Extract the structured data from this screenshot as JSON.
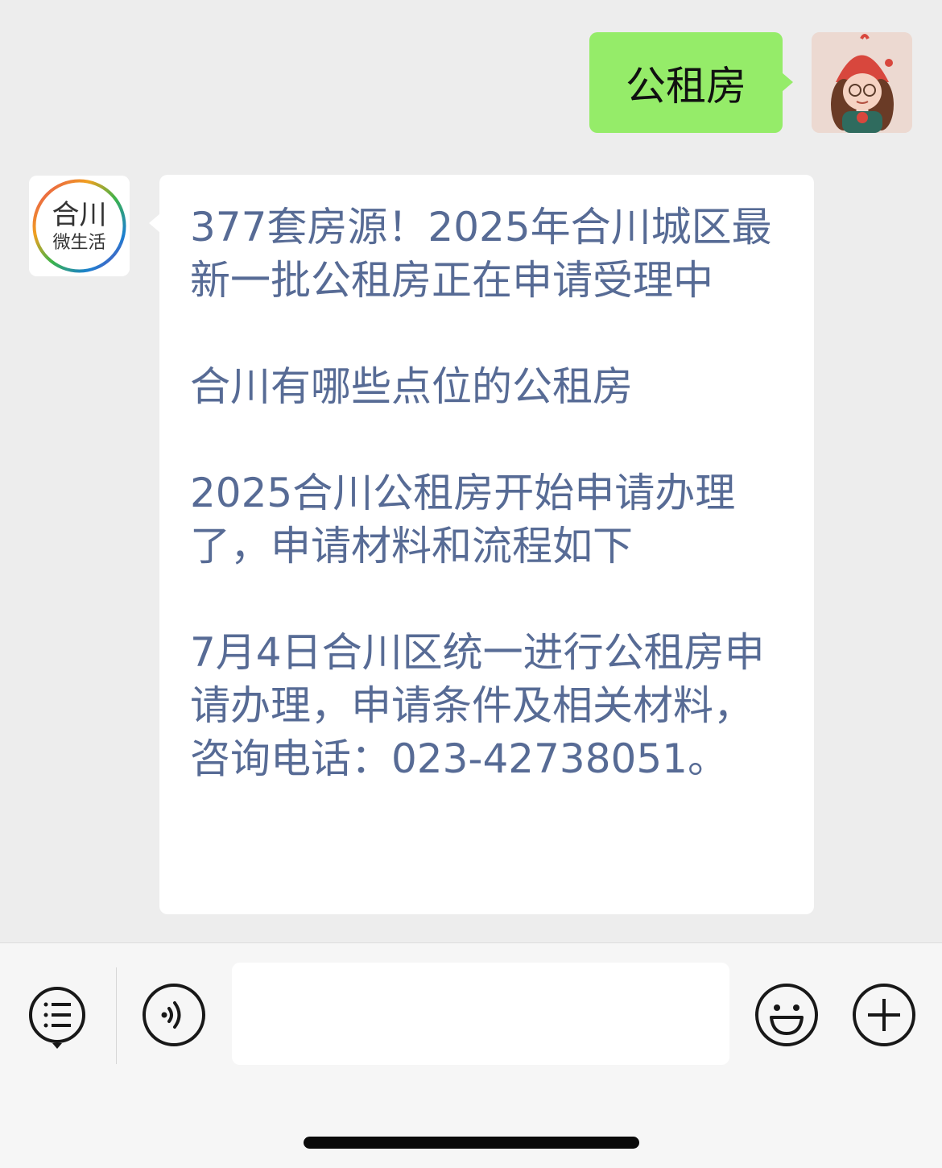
{
  "messages": {
    "outgoing": {
      "text": "公租房"
    },
    "incoming": {
      "logo_text_1": "合川",
      "logo_text_2": "微生活",
      "paragraphs": [
        "377套房源！2025年合川城区最新一批公租房正在申请受理中",
        "合川有哪些点位的公租房",
        "2025合川公租房开始申请办理了，申请材料和流程如下",
        "7月4日合川区统一进行公租房申请办理，申请条件及相关材料，咨询电话：023-42738051。"
      ]
    }
  },
  "input_bar": {
    "menu_icon": "menu-list-icon",
    "voice_icon": "voice-icon",
    "emoji_icon": "emoji-icon",
    "plus_icon": "plus-icon",
    "text_value": ""
  },
  "colors": {
    "outgoing_bubble": "#95ec69",
    "incoming_text": "#576b95",
    "background": "#ededed"
  }
}
